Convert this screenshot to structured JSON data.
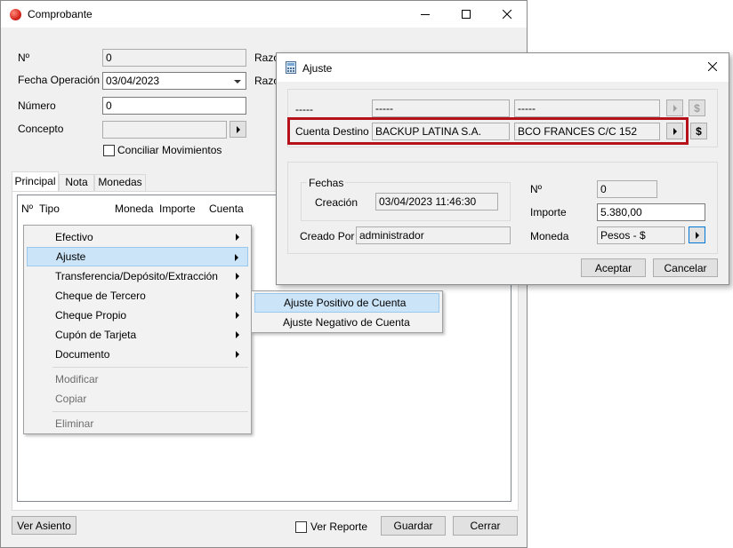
{
  "main": {
    "title": "Comprobante",
    "label_n": "Nº",
    "value_n": "0",
    "label_fecha": "Fecha Operación",
    "value_fecha": "03/04/2023",
    "label_numero": "Número",
    "value_numero": "0",
    "label_concepto": "Concepto",
    "value_concepto": "",
    "conciliar_label": "Conciliar Movimientos",
    "label_razon1": "Razó",
    "label_razon2": "Razó",
    "tabs": [
      "Principal",
      "Nota",
      "Monedas"
    ],
    "columns": [
      "Nº",
      "Tipo",
      "Moneda",
      "Importe",
      "Cuenta"
    ],
    "ver_asiento": "Ver Asiento",
    "ver_reporte": "Ver Reporte",
    "guardar": "Guardar",
    "cerrar": "Cerrar"
  },
  "context_menu": {
    "items": [
      {
        "label": "Efectivo",
        "submenu": true
      },
      {
        "label": "Ajuste",
        "submenu": true
      },
      {
        "label": "Transferencia/Depósito/Extracción",
        "submenu": true
      },
      {
        "label": "Cheque de Tercero",
        "submenu": true
      },
      {
        "label": "Cheque Propio",
        "submenu": true
      },
      {
        "label": "Cupón de Tarjeta",
        "submenu": true
      },
      {
        "label": "Documento",
        "submenu": true
      },
      {
        "label": "Modificar",
        "disabled": true
      },
      {
        "label": "Copiar",
        "disabled": true
      },
      {
        "label": "Eliminar",
        "disabled": true
      }
    ],
    "highlighted": "Ajuste"
  },
  "submenu": {
    "items": [
      {
        "label": "Ajuste Positivo de Cuenta"
      },
      {
        "label": "Ajuste Negativo de Cuenta"
      }
    ],
    "highlighted": "Ajuste Positivo de Cuenta"
  },
  "dialog": {
    "title": "Ajuste",
    "row1_label": "-----",
    "row1_field1": "-----",
    "row1_field2": "-----",
    "cuenta_destino_label": "Cuenta Destino",
    "cuenta_destino_razon": "BACKUP LATINA S.A.",
    "cuenta_destino_cuenta": "BCO FRANCES C/C 152",
    "fechas_group": "Fechas",
    "creacion_label": "Creación",
    "creacion_value": "03/04/2023 11:46:30",
    "creado_por_label": "Creado Por",
    "creado_por_value": "administrador",
    "n_label": "Nº",
    "n_value": "0",
    "importe_label": "Importe",
    "importe_value": "5.380,00",
    "moneda_label": "Moneda",
    "moneda_value": "Pesos - $",
    "aceptar": "Aceptar",
    "cancelar": "Cancelar",
    "dollar": "$"
  },
  "colors": {
    "highlight_border": "#b5121b",
    "menu_highlight": "#cce4f7",
    "app_icon": "#d7261d"
  }
}
